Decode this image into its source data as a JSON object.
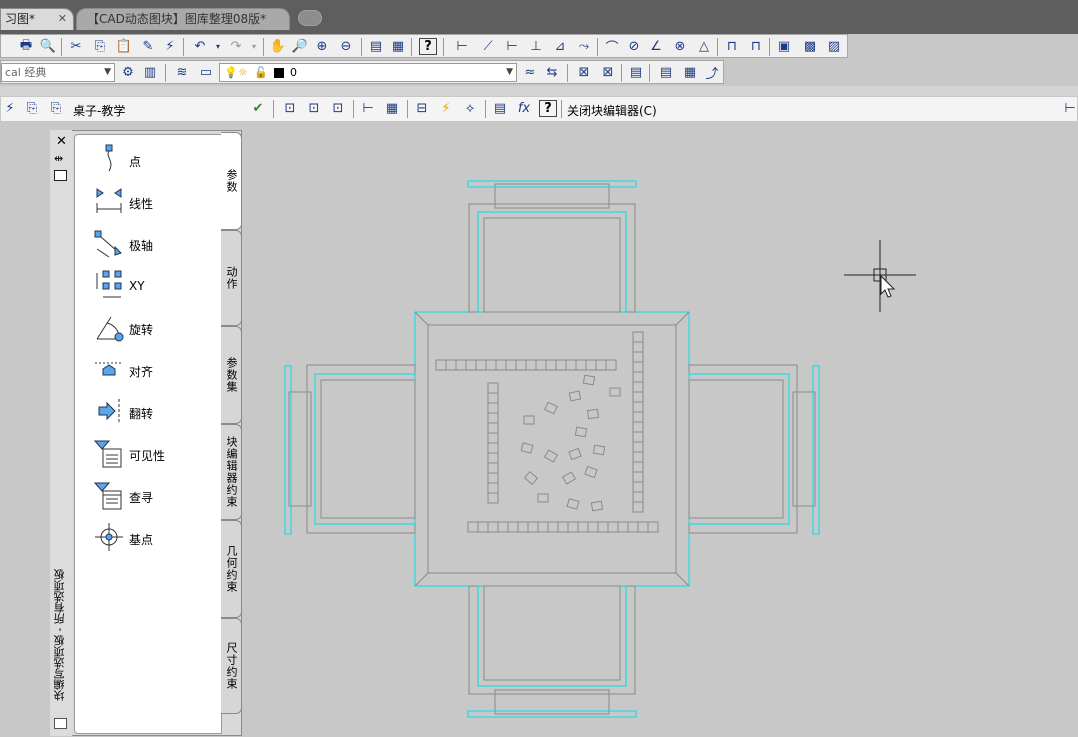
{
  "tabs": {
    "active": "习图*",
    "inactive": "【CAD动态图块】图库整理08版*"
  },
  "toolbar2": {
    "workspace": "cal 经典",
    "layer": "0"
  },
  "block_editor": {
    "block_name": "桌子-教学",
    "close_label": "关闭块编辑器(C)"
  },
  "palette": {
    "title": "块编写选项板 - 所有选项板",
    "items": [
      {
        "label": "点"
      },
      {
        "label": "线性"
      },
      {
        "label": "极轴"
      },
      {
        "label": "XY"
      },
      {
        "label": "旋转"
      },
      {
        "label": "对齐"
      },
      {
        "label": "翻转"
      },
      {
        "label": "可见性"
      },
      {
        "label": "查寻"
      },
      {
        "label": "基点"
      }
    ],
    "tabs": [
      "参数",
      "动作",
      "参数集",
      "块编辑器约束",
      "几何约束",
      "尺寸约束"
    ]
  },
  "colors": {
    "accent_cyan": "#00e0e8",
    "drawing_gray": "#8a8a8a",
    "canvas_bg": "#c8c8c8"
  }
}
